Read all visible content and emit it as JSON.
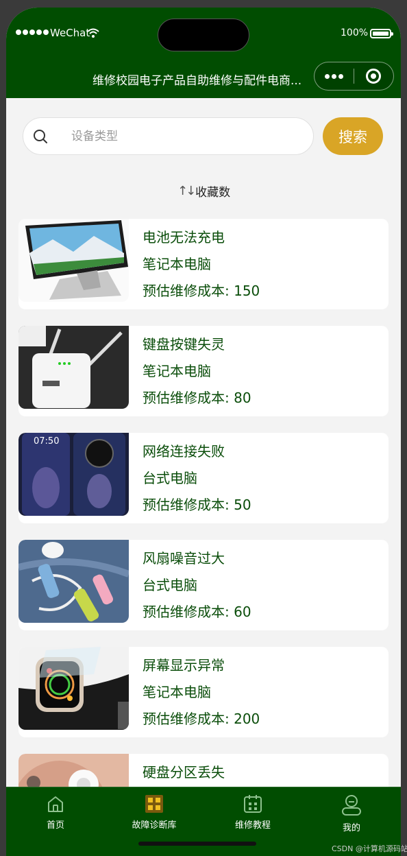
{
  "status": {
    "carrier": "WeChat",
    "battery": "100%"
  },
  "nav": {
    "title": "维修校园电子产品自助维修与配件电商..."
  },
  "search": {
    "placeholder": "设备类型",
    "button": "搜索"
  },
  "sort": {
    "label": "收藏数"
  },
  "items": [
    {
      "fault": "电池无法充电",
      "device": "笔记本电脑",
      "cost": "预估维修成本: 150",
      "image": "tablet-on-stand"
    },
    {
      "fault": "键盘按键失灵",
      "device": "笔记本电脑",
      "cost": "预估维修成本: 80",
      "image": "wifi-extender"
    },
    {
      "fault": "网络连接失败",
      "device": "台式电脑",
      "cost": "预估维修成本: 50",
      "image": "smartphones"
    },
    {
      "fault": "风扇噪音过大",
      "device": "台式电脑",
      "cost": "预估维修成本: 60",
      "image": "earphones-denim"
    },
    {
      "fault": "屏幕显示异常",
      "device": "笔记本电脑",
      "cost": "预估维修成本: 200",
      "image": "smartwatch"
    },
    {
      "fault": "硬盘分区丢失",
      "device": "",
      "cost": "",
      "image": "earbud-in-ear"
    }
  ],
  "tabs": [
    {
      "label": "首页",
      "icon": "home-icon"
    },
    {
      "label": "故障诊断库",
      "icon": "grid-icon"
    },
    {
      "label": "维修教程",
      "icon": "calendar-icon"
    },
    {
      "label": "我的",
      "icon": "user-icon"
    }
  ],
  "watermark": "CSDN @计算机源码站",
  "colors": {
    "primary": "#014d01",
    "accent": "#d9a526",
    "text": "#0a4d0a"
  }
}
